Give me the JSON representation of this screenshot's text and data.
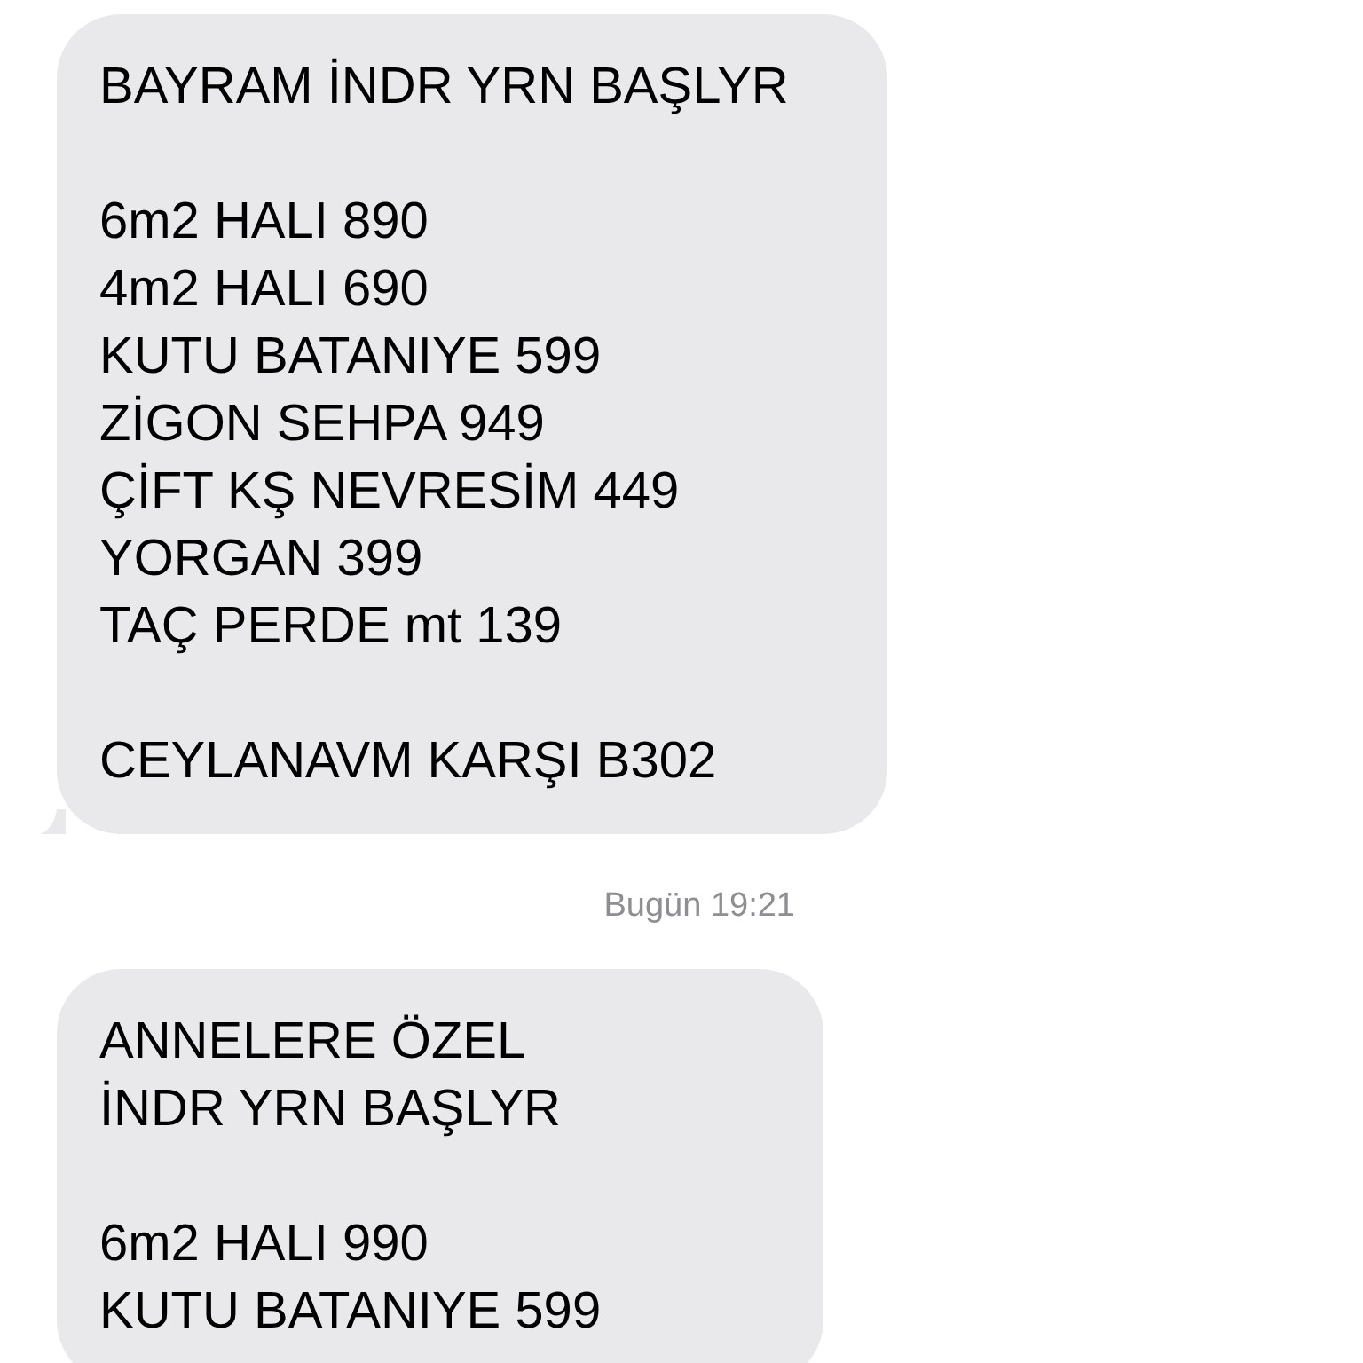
{
  "messages": [
    {
      "tail": true,
      "paragraphs": [
        [
          "BAYRAM İNDR YRN BAŞLYR"
        ],
        [
          "6m2 HALI 890",
          "4m2 HALI 690",
          "KUTU BATANIYE 599",
          "ZİGON SEHPA 949",
          "ÇİFT KŞ NEVRESİM 449",
          "YORGAN 399",
          "TAÇ PERDE mt 139"
        ],
        [
          "CEYLANAVM KARŞI B302"
        ]
      ]
    },
    {
      "timestamp": "Bugün 19:21",
      "tail": false,
      "paragraphs": [
        [
          "ANNELERE ÖZEL",
          "İNDR YRN BAŞLYR"
        ],
        [
          "6m2 HALI 990",
          "KUTU BATANIYE 599"
        ]
      ]
    }
  ]
}
